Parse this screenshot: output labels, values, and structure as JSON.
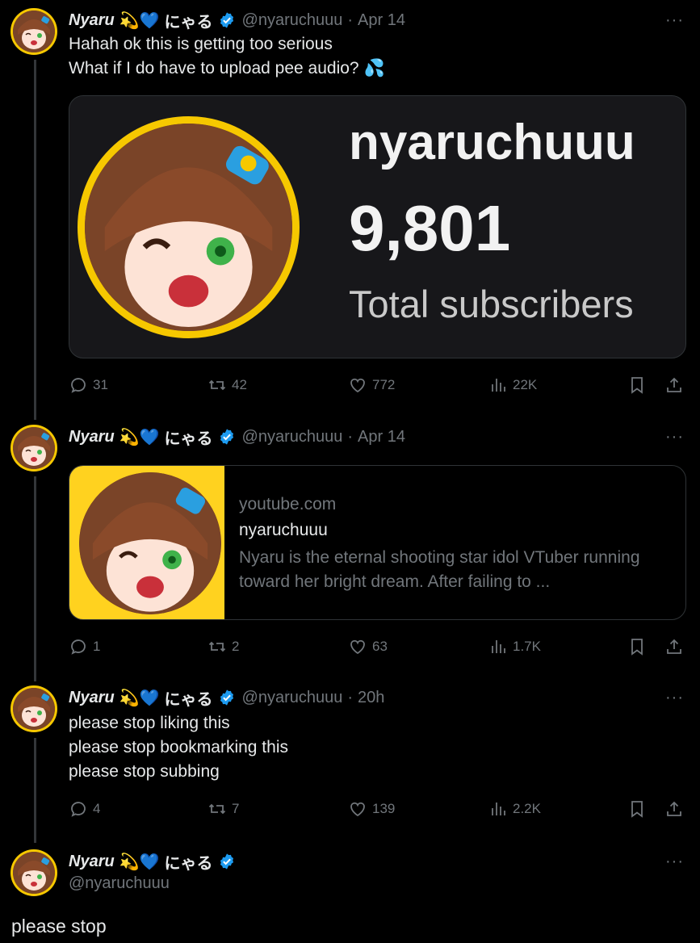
{
  "tweets": [
    {
      "display_name": "Nyaru",
      "name_jp": "にゃる",
      "handle": "@nyaruchuuu",
      "time": "Apr 14",
      "text_lines": [
        "Hahah ok this is getting too serious",
        "What if I do have to upload pee audio?"
      ],
      "text_emoji": "💦",
      "media": {
        "channel_name": "nyaruchuuu",
        "subscriber_count": "9,801",
        "subscriber_label": "Total subscribers"
      },
      "stats": {
        "replies": "31",
        "retweets": "42",
        "likes": "772",
        "views": "22K"
      }
    },
    {
      "display_name": "Nyaru",
      "name_jp": "にゃる",
      "handle": "@nyaruchuuu",
      "time": "Apr 14",
      "link_card": {
        "domain": "youtube.com",
        "title": "nyaruchuuu",
        "description": "Nyaru is the eternal shooting star idol VTuber running toward her bright dream. After failing to ..."
      },
      "stats": {
        "replies": "1",
        "retweets": "2",
        "likes": "63",
        "views": "1.7K"
      }
    },
    {
      "display_name": "Nyaru",
      "name_jp": "にゃる",
      "handle": "@nyaruchuuu",
      "time": "20h",
      "text_lines": [
        "please stop liking this",
        "please stop bookmarking this",
        "please stop subbing"
      ],
      "stats": {
        "replies": "4",
        "retweets": "7",
        "likes": "139",
        "views": "2.2K"
      }
    },
    {
      "display_name": "Nyaru",
      "name_jp": "にゃる",
      "handle": "@nyaruchuuu",
      "text": "please stop"
    }
  ],
  "name_emojis": [
    "💫",
    "💙"
  ],
  "time_separator": "·",
  "more_label": "···",
  "icons": {
    "reply": "reply-icon",
    "retweet": "retweet-icon",
    "like": "heart-icon",
    "views": "views-icon",
    "bookmark": "bookmark-icon",
    "share": "share-icon",
    "verified": "verified-badge-icon"
  },
  "colors": {
    "background": "#000000",
    "text": "#e7e9ea",
    "muted": "#71767b",
    "verified_blue": "#1d9bf0",
    "avatar_ring": "#f6c800"
  }
}
